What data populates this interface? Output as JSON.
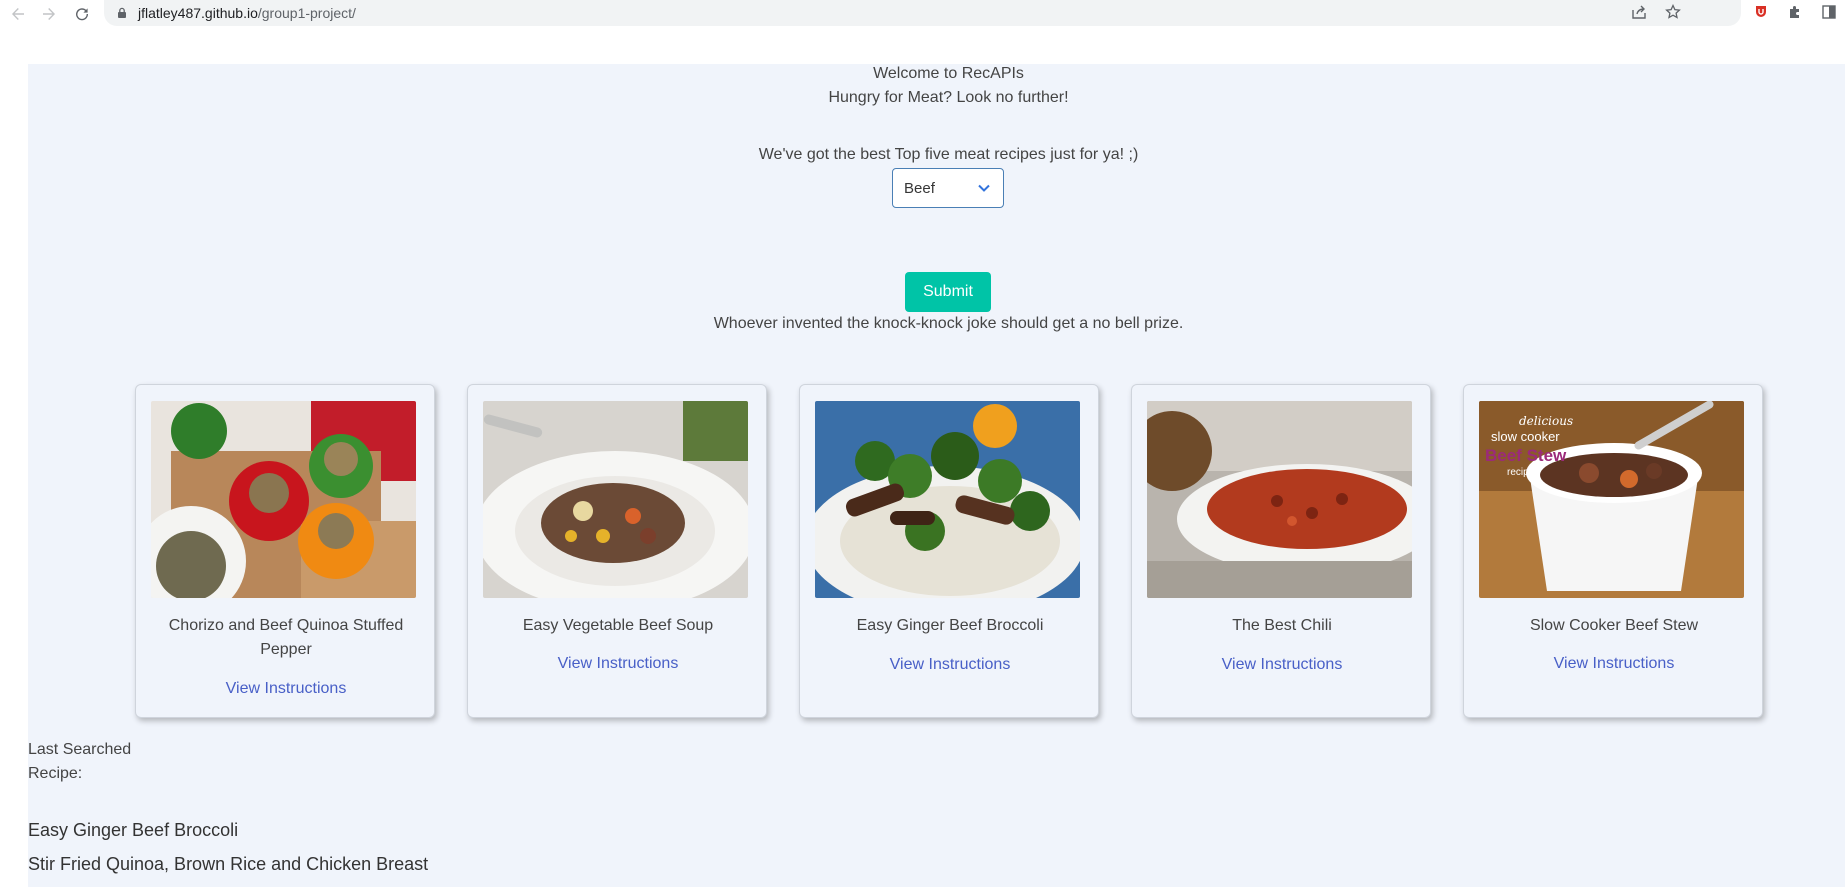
{
  "browser": {
    "url_host": "jflatley487.github.io",
    "url_path": "/group1-project/"
  },
  "intro": {
    "welcome": "Welcome to RecAPIs",
    "tagline": "Hungry for Meat? Look no further!",
    "offer": "We've got the best Top five meat recipes just for ya! ;)"
  },
  "form": {
    "selected_meat": "Beef",
    "submit_label": "Submit"
  },
  "joke": "Whoever invented the knock-knock joke should get a no bell prize.",
  "recipes": [
    {
      "title": "Chorizo and Beef Quinoa Stuffed Pepper",
      "link": "View Instructions"
    },
    {
      "title": "Easy Vegetable Beef Soup",
      "link": "View Instructions"
    },
    {
      "title": "Easy Ginger Beef Broccoli",
      "link": "View Instructions"
    },
    {
      "title": "The Best Chili",
      "link": "View Instructions"
    },
    {
      "title": "Slow Cooker Beef Stew",
      "link": "View Instructions"
    }
  ],
  "history": {
    "label": "Last Searched Recipe:",
    "items": [
      "Easy Ginger Beef Broccoli",
      "Stir Fried Quinoa, Brown Rice and Chicken Breast"
    ]
  },
  "colors": {
    "page_bg": "#f0f4fb",
    "submit": "#00c4a7",
    "link": "#485fc7"
  },
  "image_overlay_text": {
    "stew_image": [
      "delicious",
      "slow cooker",
      "Beef Stew",
      "recipe"
    ]
  }
}
